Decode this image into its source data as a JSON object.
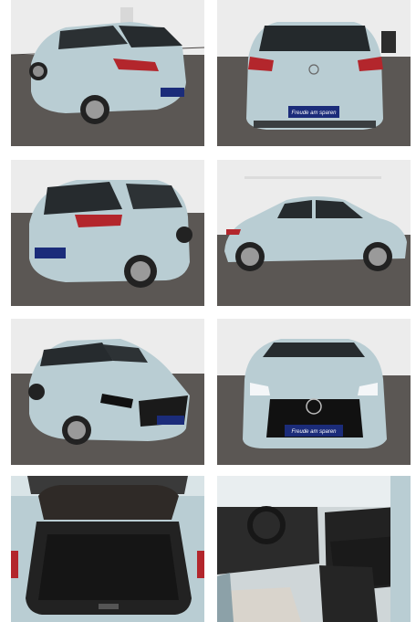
{
  "gallery": {
    "photos": [
      {
        "view": "rear-three-quarter-left"
      },
      {
        "view": "rear"
      },
      {
        "view": "rear-three-quarter-left-close"
      },
      {
        "view": "side-right"
      },
      {
        "view": "front-three-quarter-left"
      },
      {
        "view": "front"
      },
      {
        "view": "trunk-open"
      },
      {
        "view": "interior-driver-seat"
      }
    ],
    "plate_text": "Freude am sparen",
    "colors": {
      "car_body": "#b9cdd3",
      "showroom_floor": "#5b5754",
      "showroom_wall": "#ececec",
      "tail_light": "#b3262c",
      "plate_blue": "#1b2c7a",
      "interior_dark": "#2b2b2b"
    }
  }
}
